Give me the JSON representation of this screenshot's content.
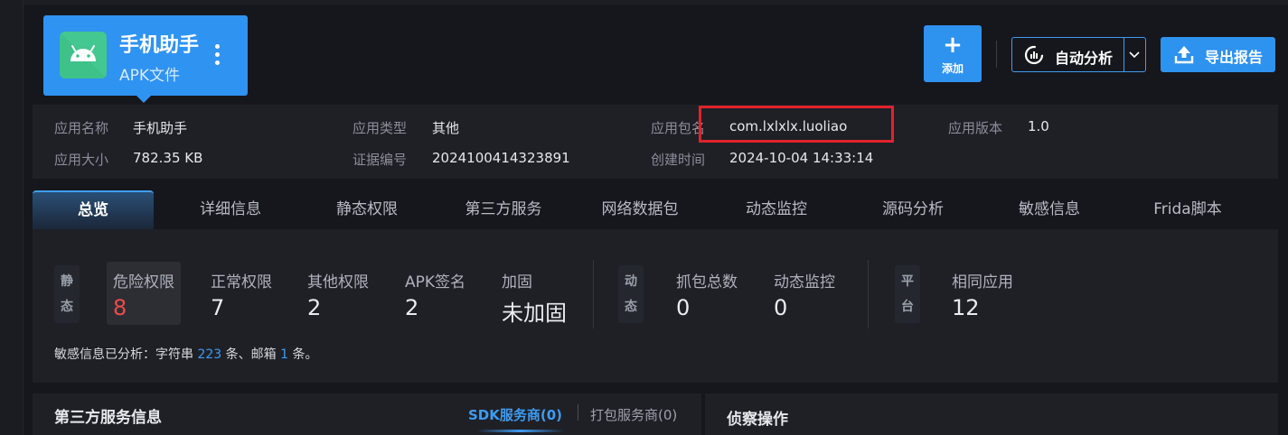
{
  "app": {
    "name": "手机助手",
    "type_label": "APK文件"
  },
  "toolbar": {
    "add_label": "添加",
    "add_symbol": "+",
    "auto_analysis_label": "自动分析",
    "export_label": "导出报告"
  },
  "info": {
    "app_name_key": "应用名称",
    "app_name_val": "手机助手",
    "app_type_key": "应用类型",
    "app_type_val": "其他",
    "package_key": "应用包名",
    "package_val": "com.lxlxlx.luoliao",
    "version_key": "应用版本",
    "version_val": "1.0",
    "size_key": "应用大小",
    "size_val": "782.35 KB",
    "evidence_key": "证据编号",
    "evidence_val": "2024100414323891",
    "created_key": "创建时间",
    "created_val": "2024-10-04 14:33:14"
  },
  "tabs": [
    "总览",
    "详细信息",
    "静态权限",
    "第三方服务",
    "网络数据包",
    "动态监控",
    "源码分析",
    "敏感信息",
    "Frida脚本"
  ],
  "overview": {
    "static_tag": [
      "静",
      "态"
    ],
    "dynamic_tag": [
      "动",
      "态"
    ],
    "platform_tag": [
      "平",
      "台"
    ],
    "static_stats": [
      {
        "label": "危险权限",
        "value": "8"
      },
      {
        "label": "正常权限",
        "value": "7"
      },
      {
        "label": "其他权限",
        "value": "2"
      },
      {
        "label": "APK签名",
        "value": "2"
      },
      {
        "label": "加固",
        "value": "未加固"
      }
    ],
    "dynamic_stats": [
      {
        "label": "抓包总数",
        "value": "0"
      },
      {
        "label": "动态监控",
        "value": "0"
      }
    ],
    "platform_stats": [
      {
        "label": "相同应用",
        "value": "12"
      }
    ],
    "sensitive": {
      "prefix": "敏感信息已分析：字符串 ",
      "strings_count": "223",
      "mid": " 条、邮箱 ",
      "email_count": "1",
      "suffix": " 条。"
    }
  },
  "third_party": {
    "title": "第三方服务信息",
    "sdk_tab": "SDK服务商(0)",
    "pack_tab": "打包服务商(0)"
  },
  "recon": {
    "title": "侦察操作"
  },
  "colors": {
    "accent": "#2e92ef",
    "danger": "#ee4a4a",
    "highlight": "#e2222b",
    "android_green": "#3ec28a"
  }
}
